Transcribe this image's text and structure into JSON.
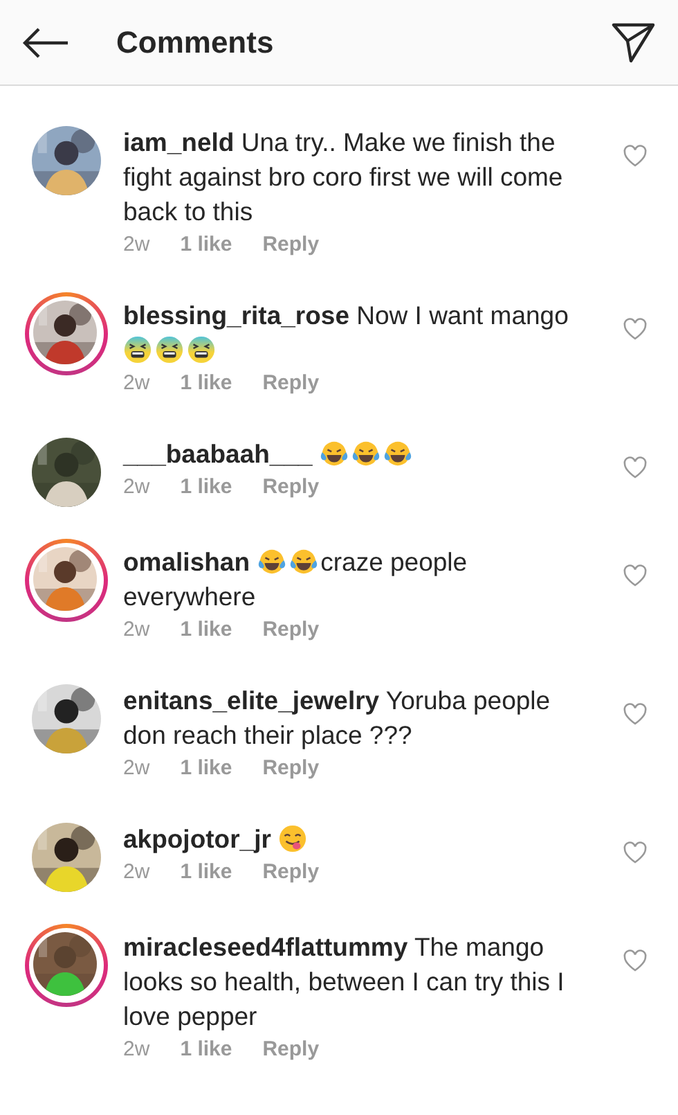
{
  "header": {
    "title": "Comments"
  },
  "comments": [
    {
      "username": "iam_neld",
      "story_ring": false,
      "parts": [
        {
          "kind": "text",
          "text": "Una try.. Make we finish the fight against bro coro first we will come back to this"
        }
      ],
      "time": "2w",
      "likes": "1 like",
      "reply": "Reply",
      "liked": false
    },
    {
      "username": "blessing_rita_rose",
      "story_ring": true,
      "parts": [
        {
          "kind": "text",
          "text": "Now I want mango"
        },
        {
          "kind": "tired"
        },
        {
          "kind": "tired"
        },
        {
          "kind": "tired"
        }
      ],
      "time": "2w",
      "likes": "1 like",
      "reply": "Reply",
      "liked": false
    },
    {
      "username": "___baabaah___",
      "story_ring": false,
      "parts": [
        {
          "kind": "tears"
        },
        {
          "kind": "tears"
        },
        {
          "kind": "tears"
        }
      ],
      "time": "2w",
      "likes": "1 like",
      "reply": "Reply",
      "liked": false
    },
    {
      "username": "omalishan",
      "story_ring": true,
      "parts": [
        {
          "kind": "tears"
        },
        {
          "kind": "tears"
        },
        {
          "kind": "text",
          "text": "craze people everywhere"
        }
      ],
      "time": "2w",
      "likes": "1 like",
      "reply": "Reply",
      "liked": false
    },
    {
      "username": "enitans_elite_jewelry",
      "story_ring": false,
      "parts": [
        {
          "kind": "text",
          "text": "Yoruba people don reach their place ???"
        }
      ],
      "time": "2w",
      "likes": "1 like",
      "reply": "Reply",
      "liked": false
    },
    {
      "username": "akpojotor_jr",
      "story_ring": false,
      "parts": [
        {
          "kind": "yum"
        }
      ],
      "time": "2w",
      "likes": "1 like",
      "reply": "Reply",
      "liked": false
    },
    {
      "username": "miracleseed4flattummy",
      "story_ring": true,
      "parts": [
        {
          "kind": "text",
          "text": "The mango looks so health, between I can try this I love pepper"
        }
      ],
      "time": "2w",
      "likes": "1 like",
      "reply": "Reply",
      "liked": false
    }
  ]
}
